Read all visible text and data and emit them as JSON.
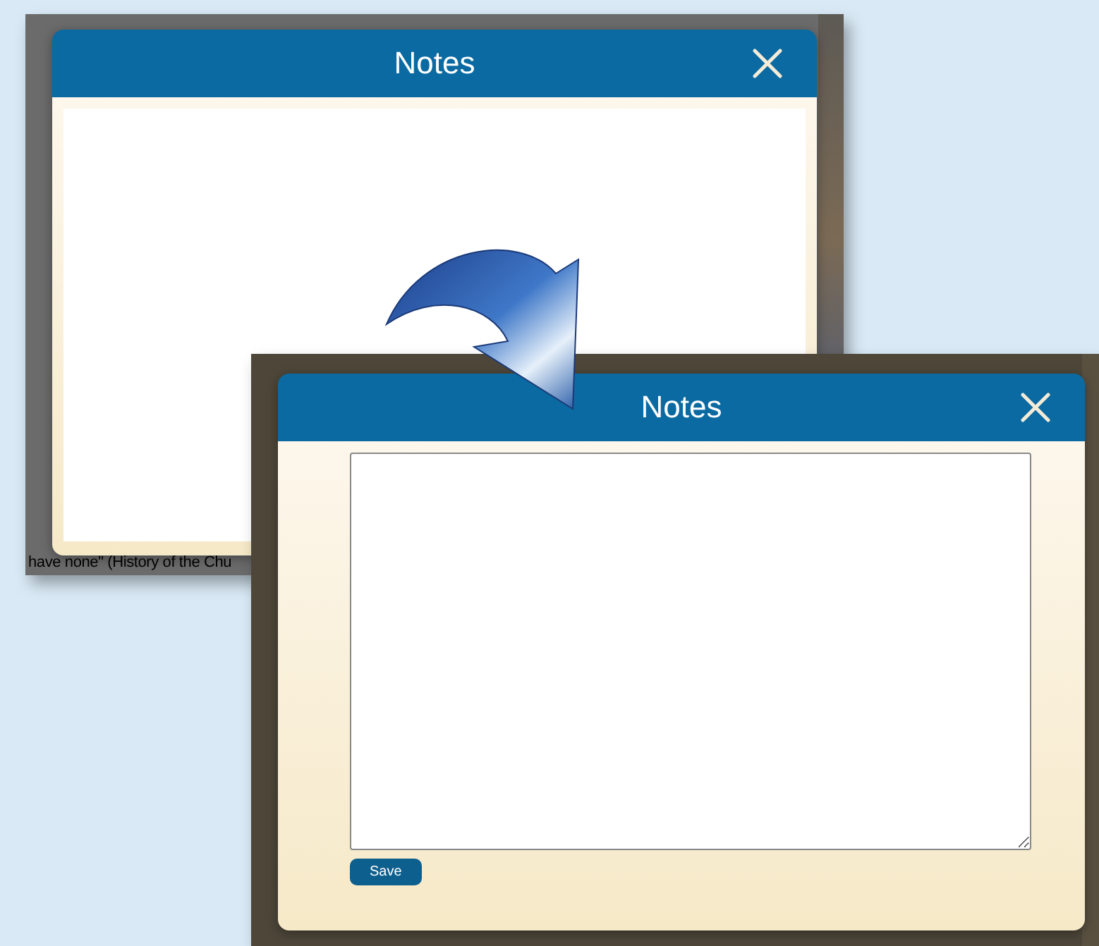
{
  "screenshots": [
    {
      "background_text": "have none\" (History of the Chu",
      "notes_dialog": {
        "title": "Notes"
      }
    },
    {
      "notes_dialog": {
        "title": "Notes",
        "save_button": "Save"
      }
    }
  ]
}
